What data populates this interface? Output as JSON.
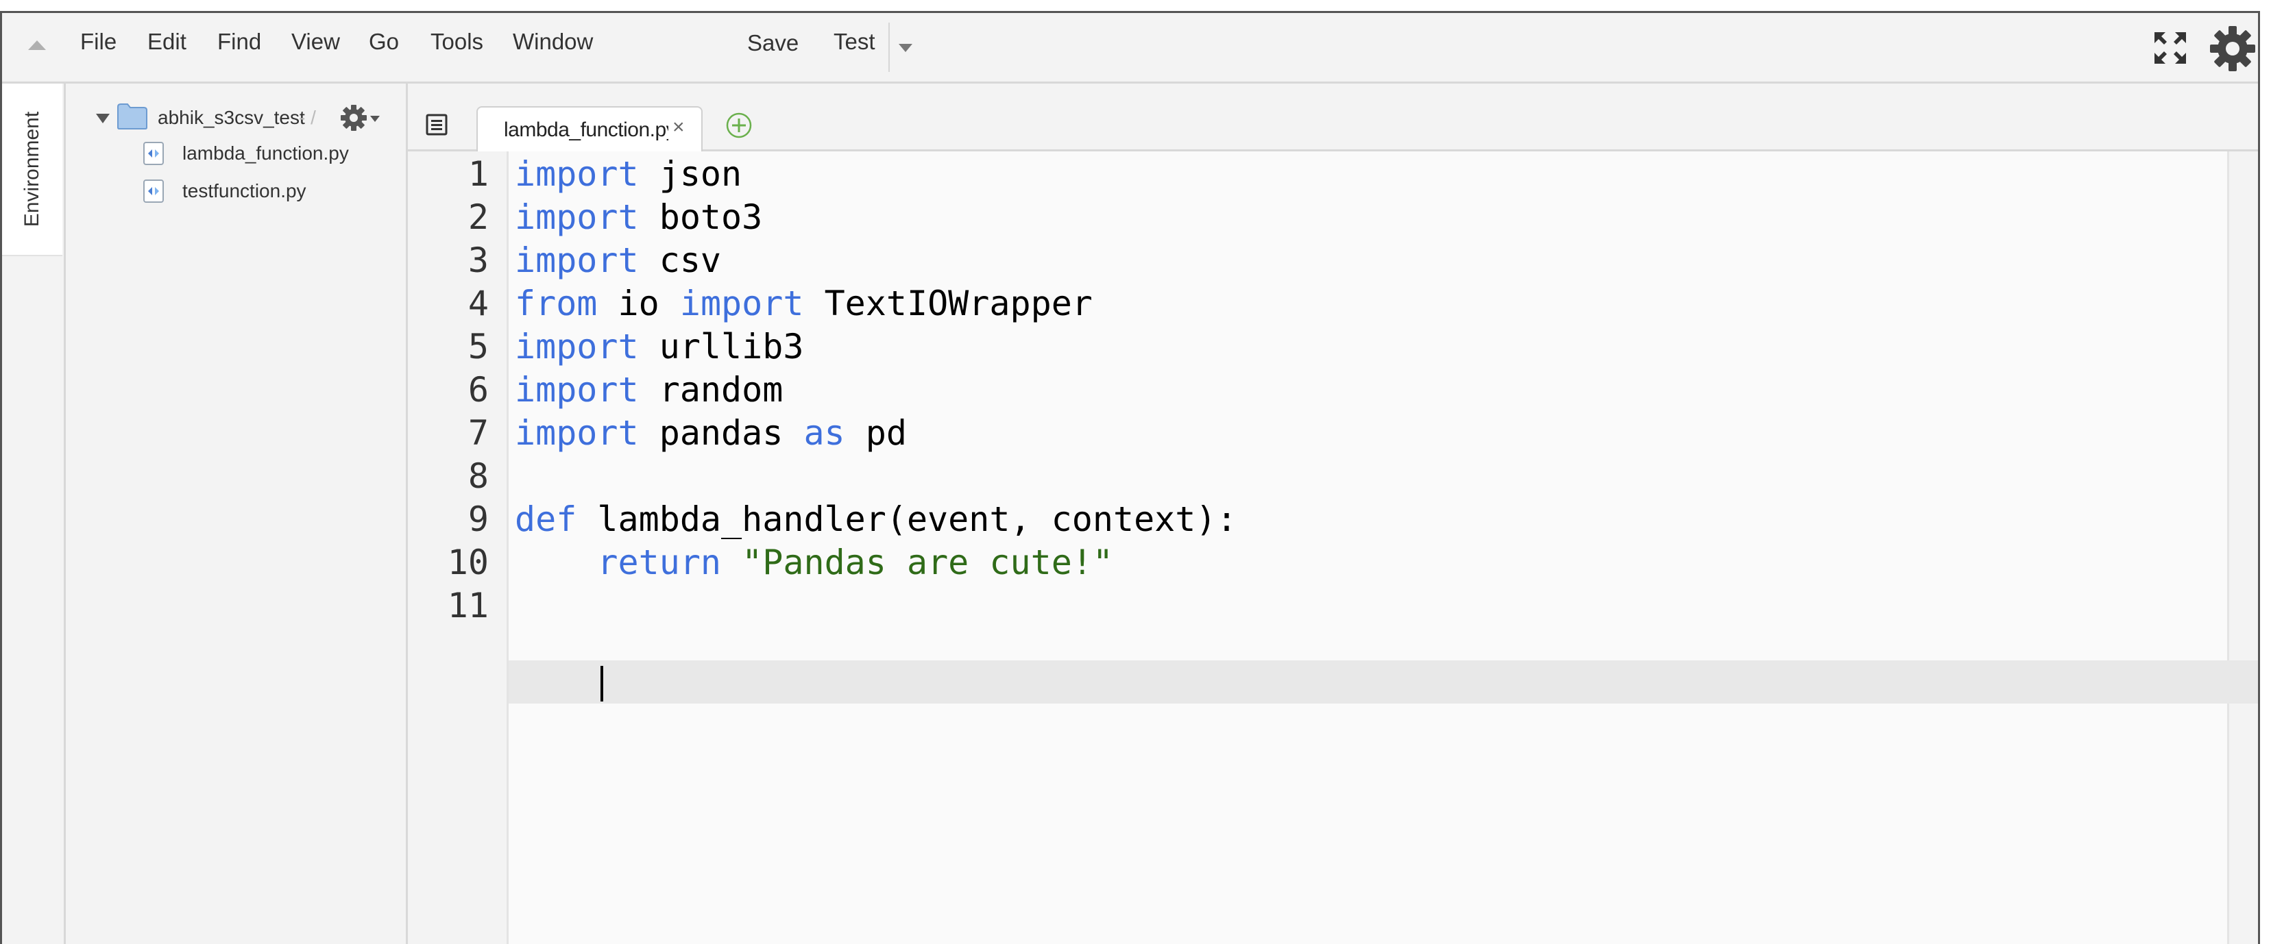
{
  "menu": {
    "file": "File",
    "edit": "Edit",
    "find": "Find",
    "view": "View",
    "go": "Go",
    "tools": "Tools",
    "window": "Window",
    "save": "Save",
    "test": "Test"
  },
  "left_rail": {
    "environment_label": "Environment"
  },
  "file_tree": {
    "folder": {
      "name": "abhik_s3csv_test",
      "suffix": "- /"
    },
    "files": [
      "lambda_function.py",
      "testfunction.py"
    ]
  },
  "editor": {
    "active_tab": "lambda_function.py",
    "tab_close_glyph": "×",
    "line_numbers": [
      "1",
      "2",
      "3",
      "4",
      "5",
      "6",
      "7",
      "8",
      "9",
      "10",
      "11"
    ],
    "lines": [
      [
        {
          "t": "import",
          "c": "kw"
        },
        {
          "t": " json",
          "c": ""
        }
      ],
      [
        {
          "t": "import",
          "c": "kw"
        },
        {
          "t": " boto3",
          "c": ""
        }
      ],
      [
        {
          "t": "import",
          "c": "kw"
        },
        {
          "t": " csv",
          "c": ""
        }
      ],
      [
        {
          "t": "from",
          "c": "kw"
        },
        {
          "t": " io ",
          "c": ""
        },
        {
          "t": "import",
          "c": "kw"
        },
        {
          "t": " TextIOWrapper",
          "c": ""
        }
      ],
      [
        {
          "t": "import",
          "c": "kw"
        },
        {
          "t": " urllib3",
          "c": ""
        }
      ],
      [
        {
          "t": "import",
          "c": "kw"
        },
        {
          "t": " random",
          "c": ""
        }
      ],
      [
        {
          "t": "import",
          "c": "kw"
        },
        {
          "t": " pandas ",
          "c": ""
        },
        {
          "t": "as",
          "c": "kw"
        },
        {
          "t": " pd",
          "c": ""
        }
      ],
      [],
      [
        {
          "t": "def",
          "c": "kw"
        },
        {
          "t": " lambda_handler(event, context):",
          "c": ""
        }
      ],
      [
        {
          "t": "    ",
          "c": ""
        },
        {
          "t": "return",
          "c": "kw"
        },
        {
          "t": " ",
          "c": ""
        },
        {
          "t": "\"Pandas are cute!\"",
          "c": "str"
        }
      ],
      [
        {
          "t": "    ",
          "c": ""
        }
      ]
    ],
    "active_line": 11
  },
  "colors": {
    "keyword": "#3e6fdc",
    "string": "#2f6b18",
    "accent_green": "#6ab04c"
  },
  "icons": [
    "collapse-arrow-icon",
    "fullscreen-icon",
    "gear-icon",
    "folder-icon",
    "python-file-icon",
    "tab-list-icon",
    "add-tab-icon",
    "close-icon"
  ]
}
